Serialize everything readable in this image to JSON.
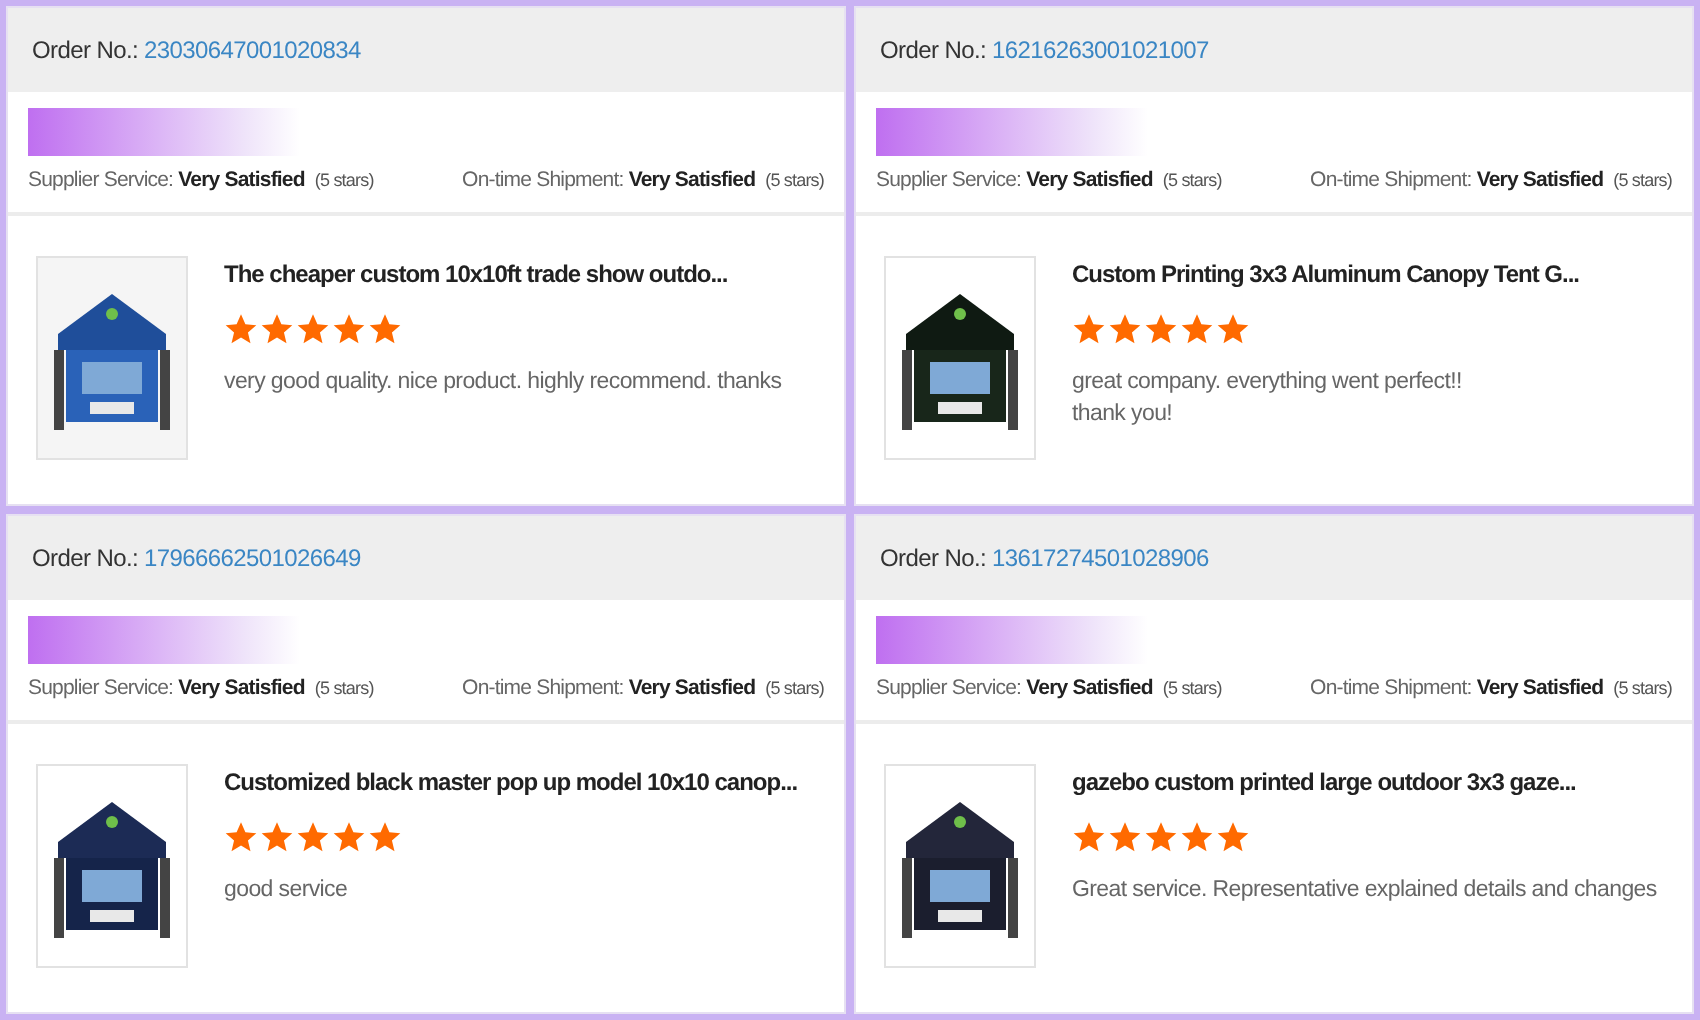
{
  "orders": [
    {
      "order_label": "Order No.:",
      "order_number": "23030647001020834",
      "ratings": [
        {
          "label": "Supplier Service:",
          "value": "Very Satisfied",
          "note": "(5 stars)"
        },
        {
          "label": "On-time Shipment:",
          "value": "Very Satisfied",
          "note": "(5 stars)"
        }
      ],
      "product": {
        "title": "The cheaper custom 10x10ft trade show outdo...",
        "stars": 5,
        "comment_lines": [
          "very good quality. nice product. highly recommend. thanks"
        ]
      }
    },
    {
      "order_label": "Order No.:",
      "order_number": "16216263001021007",
      "ratings": [
        {
          "label": "Supplier Service:",
          "value": "Very Satisfied",
          "note": "(5 stars)"
        },
        {
          "label": "On-time Shipment:",
          "value": "Very Satisfied",
          "note": "(5 stars)"
        }
      ],
      "product": {
        "title": "Custom Printing 3x3 Aluminum Canopy Tent G...",
        "stars": 5,
        "comment_lines": [
          "great company. everything went perfect!!",
          "thank you!"
        ]
      }
    },
    {
      "order_label": "Order No.:",
      "order_number": "17966662501026649",
      "ratings": [
        {
          "label": "Supplier Service:",
          "value": "Very Satisfied",
          "note": "(5 stars)"
        },
        {
          "label": "On-time Shipment:",
          "value": "Very Satisfied",
          "note": "(5 stars)"
        }
      ],
      "product": {
        "title": "Customized black master pop up model 10x10 canop...",
        "stars": 5,
        "comment_lines": [
          "good service"
        ]
      }
    },
    {
      "order_label": "Order No.:",
      "order_number": "13617274501028906",
      "ratings": [
        {
          "label": "Supplier Service:",
          "value": "Very Satisfied",
          "note": "(5 stars)"
        },
        {
          "label": "On-time Shipment:",
          "value": "Very Satisfied",
          "note": "(5 stars)"
        }
      ],
      "product": {
        "title": "gazebo custom printed large outdoor 3x3 gaze...",
        "stars": 5,
        "comment_lines": [
          "Great service. Representative explained details and changes"
        ]
      }
    }
  ]
}
